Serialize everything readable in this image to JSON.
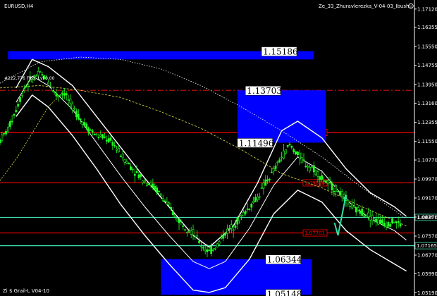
{
  "header": {
    "symbol": "EURUSD,H4",
    "indicator": "Ze_33_Zhuravlerezka_V-04-03_Ibush",
    "footer": "Zi $ Grail-L V04-10",
    "fib_note": "#222.776 Fibo. Lvl 0.00",
    "smiley_icon": "smiley-icon"
  },
  "chart_data": {
    "type": "candlestick",
    "title": "EURUSD,H4",
    "xlabel": "",
    "ylabel": "",
    "ylim": [
      1.0505,
      1.175
    ],
    "y_ticks": [
      "1.17120",
      "1.16355",
      "1.15550",
      "1.14755",
      "1.13950",
      "1.13160",
      "1.12355",
      "1.11550",
      "1.10770",
      "1.09970",
      "1.09170",
      "1.08370",
      "1.07570",
      "1.06770",
      "1.05990",
      "1.05190"
    ],
    "grid": false,
    "price_path": [
      [
        0,
        1.116
      ],
      [
        4,
        1.1205
      ],
      [
        8,
        1.129
      ],
      [
        12,
        1.138
      ],
      [
        16,
        1.142
      ],
      [
        20,
        1.144
      ],
      [
        24,
        1.141
      ],
      [
        28,
        1.135
      ],
      [
        32,
        1.136
      ],
      [
        36,
        1.13
      ],
      [
        40,
        1.125
      ],
      [
        44,
        1.121
      ],
      [
        48,
        1.118
      ],
      [
        52,
        1.117
      ],
      [
        56,
        1.115
      ],
      [
        60,
        1.11
      ],
      [
        64,
        1.106
      ],
      [
        68,
        1.102
      ],
      [
        72,
        1.099
      ],
      [
        76,
        1.097
      ],
      [
        80,
        1.093
      ],
      [
        84,
        1.088
      ],
      [
        88,
        1.083
      ],
      [
        92,
        1.08
      ],
      [
        96,
        1.077
      ],
      [
        100,
        1.072
      ],
      [
        104,
        1.069
      ],
      [
        108,
        1.072
      ],
      [
        112,
        1.077
      ],
      [
        116,
        1.08
      ],
      [
        120,
        1.084
      ],
      [
        124,
        1.088
      ],
      [
        128,
        1.092
      ],
      [
        132,
        1.098
      ],
      [
        136,
        1.103
      ],
      [
        140,
        1.109
      ],
      [
        144,
        1.114
      ],
      [
        148,
        1.11
      ],
      [
        152,
        1.106
      ],
      [
        156,
        1.104
      ],
      [
        160,
        1.1
      ],
      [
        164,
        1.097
      ],
      [
        168,
        1.095
      ],
      [
        172,
        1.091
      ],
      [
        176,
        1.087
      ],
      [
        180,
        1.086
      ],
      [
        184,
        1.084
      ],
      [
        188,
        1.082
      ],
      [
        192,
        1.081
      ],
      [
        196,
        1.082
      ],
      [
        200,
        1.08
      ]
    ],
    "bands": {
      "upper": [
        [
          8,
          1.138
        ],
        [
          16,
          1.15
        ],
        [
          24,
          1.147
        ],
        [
          36,
          1.139
        ],
        [
          48,
          1.126
        ],
        [
          60,
          1.113
        ],
        [
          72,
          1.1
        ],
        [
          84,
          1.088
        ],
        [
          96,
          1.076
        ],
        [
          104,
          1.071
        ],
        [
          116,
          1.08
        ],
        [
          128,
          1.098
        ],
        [
          140,
          1.12
        ],
        [
          148,
          1.124
        ],
        [
          160,
          1.117
        ],
        [
          172,
          1.104
        ],
        [
          184,
          1.094
        ],
        [
          196,
          1.088
        ],
        [
          202,
          1.084
        ]
      ],
      "lower": [
        [
          8,
          1.126
        ],
        [
          16,
          1.135
        ],
        [
          24,
          1.13
        ],
        [
          36,
          1.118
        ],
        [
          48,
          1.104
        ],
        [
          60,
          1.089
        ],
        [
          72,
          1.076
        ],
        [
          84,
          1.064
        ],
        [
          96,
          1.053
        ],
        [
          104,
          1.052
        ],
        [
          112,
          1.054
        ],
        [
          124,
          1.066
        ],
        [
          136,
          1.085
        ],
        [
          148,
          1.095
        ],
        [
          160,
          1.09
        ],
        [
          172,
          1.078
        ],
        [
          184,
          1.07
        ],
        [
          196,
          1.064
        ],
        [
          202,
          1.061
        ]
      ],
      "mid": [
        [
          8,
          1.132
        ],
        [
          16,
          1.143
        ],
        [
          24,
          1.139
        ],
        [
          36,
          1.129
        ],
        [
          48,
          1.115
        ],
        [
          60,
          1.101
        ],
        [
          72,
          1.088
        ],
        [
          84,
          1.076
        ],
        [
          96,
          1.065
        ],
        [
          104,
          1.062
        ],
        [
          112,
          1.065
        ],
        [
          124,
          1.079
        ],
        [
          136,
          1.097
        ],
        [
          148,
          1.109
        ],
        [
          160,
          1.103
        ],
        [
          172,
          1.091
        ],
        [
          184,
          1.083
        ],
        [
          196,
          1.078
        ],
        [
          202,
          1.074
        ]
      ],
      "ma_yellow": [
        [
          0,
          1.138
        ],
        [
          20,
          1.139
        ],
        [
          40,
          1.137
        ],
        [
          60,
          1.134
        ],
        [
          80,
          1.128
        ],
        [
          100,
          1.121
        ],
        [
          120,
          1.112
        ],
        [
          140,
          1.102
        ],
        [
          160,
          1.096
        ],
        [
          180,
          1.088
        ],
        [
          202,
          1.08
        ]
      ],
      "ma_white_slow": [
        [
          0,
          1.14
        ],
        [
          20,
          1.149
        ],
        [
          40,
          1.151
        ],
        [
          60,
          1.15
        ],
        [
          80,
          1.146
        ],
        [
          100,
          1.139
        ],
        [
          120,
          1.13
        ],
        [
          140,
          1.12
        ],
        [
          160,
          1.109
        ],
        [
          180,
          1.096
        ],
        [
          202,
          1.083
        ]
      ],
      "ma_left_yellow": [
        [
          0,
          1.099
        ],
        [
          8,
          1.108
        ],
        [
          16,
          1.119
        ],
        [
          24,
          1.13
        ],
        [
          32,
          1.137
        ]
      ]
    },
    "horizontal_lines": [
      {
        "value": 1.137,
        "color": "#d01010",
        "style": "dashdot",
        "label": ""
      },
      {
        "value": 1.1193,
        "color": "#ff0000",
        "style": "solid",
        "label": "1.11930"
      },
      {
        "value": 1.0981,
        "color": "#ff0000",
        "style": "solid",
        "label": "1.09810"
      },
      {
        "value": 1.08357,
        "color": "#40e0b0",
        "style": "solid",
        "label": "1.08357"
      },
      {
        "value": 1.07701,
        "color": "#ff0000",
        "style": "solid",
        "label": "1.07701"
      },
      {
        "value": 1.07165,
        "color": "#40e0b0",
        "style": "solid",
        "label": "1.07165"
      }
    ],
    "boxes": [
      {
        "label": "1.15186",
        "top": 1.1535,
        "bottom": 1.15,
        "x0": 4,
        "x1": 156,
        "label_x": 130
      },
      {
        "label": "1.13703",
        "top": 1.137,
        "bottom": 1.115,
        "x0": 118,
        "x1": 162,
        "label_x": 122
      },
      {
        "label": "1.11496",
        "top": 1.115,
        "bottom": 1.115,
        "x0": 118,
        "x1": 118,
        "label_x": 118
      },
      {
        "label": "1.06344",
        "top": 1.066,
        "bottom": 1.051,
        "x0": 80,
        "x1": 155,
        "label_x": 132
      },
      {
        "label": "1.05148",
        "top": 1.0515,
        "bottom": 1.0515,
        "x0": 132,
        "x1": 132,
        "label_x": 132
      }
    ],
    "arrow": {
      "from": [
        168,
        1.076
      ],
      "to": [
        172,
        1.093
      ],
      "color": "#30e0a0"
    }
  },
  "colors": {
    "background": "#000000",
    "candle": "#22ff22",
    "box": "#0000ff",
    "band": "#ffffff",
    "ma": "#e0e040",
    "axis": "#ffffff"
  }
}
